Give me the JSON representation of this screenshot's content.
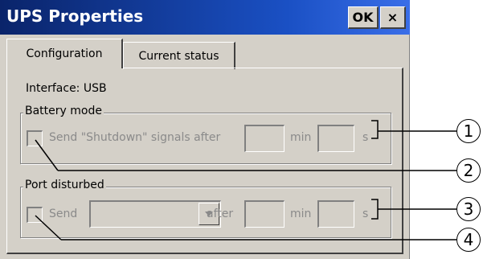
{
  "window": {
    "title": "UPS Properties",
    "ok_label": "OK",
    "close_label": "×"
  },
  "tabs": [
    {
      "label": "Configuration"
    },
    {
      "label": "Current status"
    }
  ],
  "interface": {
    "label": "Interface: USB"
  },
  "battery_mode": {
    "group_label": "Battery mode",
    "checkbox_label": "Send \"Shutdown\" signals after",
    "min_unit": "min",
    "s_unit": "s"
  },
  "port_disturbed": {
    "group_label": "Port disturbed",
    "send_label": "Send",
    "after_label": "after",
    "min_unit": "min",
    "s_unit": "s"
  },
  "callouts": [
    "1",
    "2",
    "3",
    "4"
  ]
}
